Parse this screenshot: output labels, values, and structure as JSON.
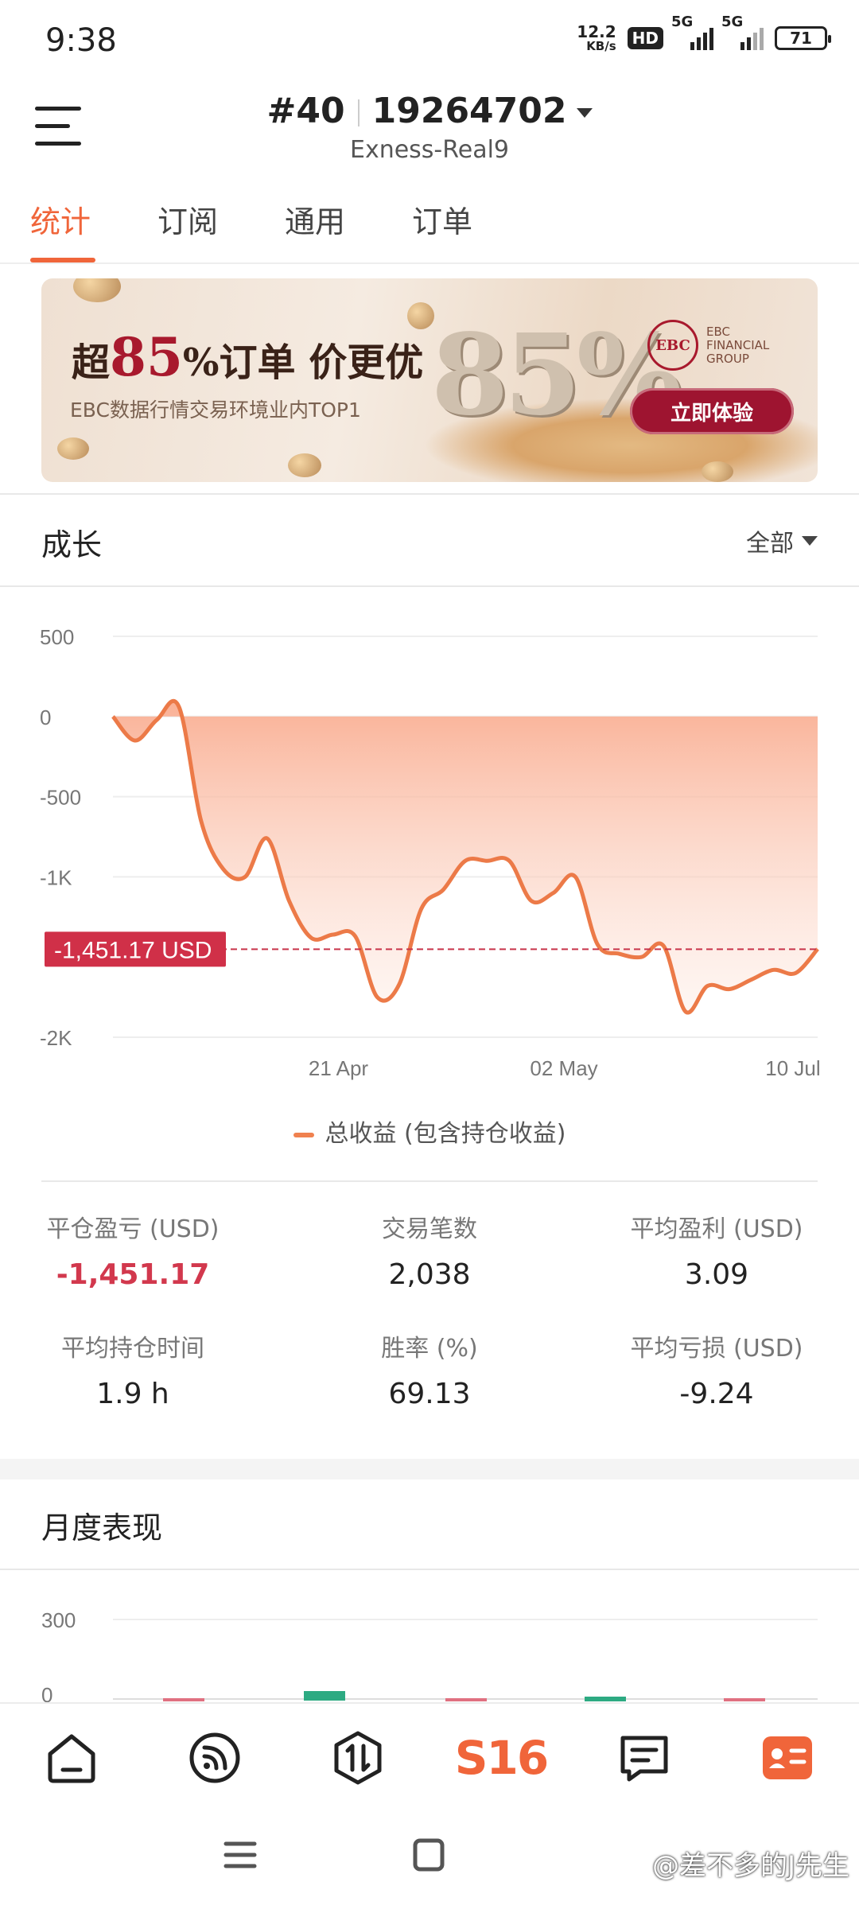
{
  "status_bar": {
    "time": "9:38",
    "net_speed_value": "12.2",
    "net_speed_unit": "KB/s",
    "hd_label": "HD",
    "sim1_label": "5G",
    "sim2_label": "5G",
    "battery": "71"
  },
  "header": {
    "rank": "#40",
    "account_number": "19264702",
    "server": "Exness-Real9"
  },
  "tabs": [
    {
      "label": "统计",
      "active": true
    },
    {
      "label": "订阅",
      "active": false
    },
    {
      "label": "通用",
      "active": false
    },
    {
      "label": "订单",
      "active": false
    }
  ],
  "banner": {
    "headline_prefix": "超",
    "headline_number": "85",
    "headline_suffix": "%订单 价更优",
    "subtitle": "EBC数据行情交易环境业内TOP1",
    "big_number": "85%",
    "logo_mark": "EBC",
    "logo_text_1": "EBC",
    "logo_text_2": "FINANCIAL",
    "logo_text_3": "GROUP",
    "cta_label": "立即体验"
  },
  "growth": {
    "title": "成长",
    "filter_label": "全部"
  },
  "chart_data": {
    "type": "area",
    "ylim": [
      -2000,
      500
    ],
    "y_ticks": [
      "500",
      "0",
      "-500",
      "-1K",
      "-2K"
    ],
    "x_tick_labels": [
      "21 Apr",
      "02 May",
      "10 Jul"
    ],
    "current_label": "-1,451.17 USD",
    "current_value": -1451.17,
    "series": [
      {
        "name": "总收益 (包含持仓收益)",
        "color": "#f0814f",
        "values": [
          0,
          -150,
          -20,
          60,
          -650,
          -950,
          -1000,
          -760,
          -1150,
          -1380,
          -1360,
          -1370,
          -1750,
          -1670,
          -1200,
          -1080,
          -900,
          -900,
          -900,
          -1150,
          -1100,
          -1000,
          -1420,
          -1480,
          -1500,
          -1430,
          -1840,
          -1680,
          -1700,
          -1640,
          -1580,
          -1600,
          -1450
        ]
      }
    ]
  },
  "legend_label": "总收益 (包含持仓收益)",
  "stats": [
    {
      "label": "平仓盈亏 (USD)",
      "value": "-1,451.17",
      "negative": true
    },
    {
      "label": "交易笔数",
      "value": "2,038",
      "negative": false
    },
    {
      "label": "平均盈利 (USD)",
      "value": "3.09",
      "negative": false
    },
    {
      "label": "平均持仓时间",
      "value": "1.9 h",
      "negative": false
    },
    {
      "label": "胜率 (%)",
      "value": "69.13",
      "negative": false
    },
    {
      "label": "平均亏损 (USD)",
      "value": "-9.24",
      "negative": false
    }
  ],
  "monthly": {
    "title": "月度表现",
    "y_ticks": [
      "300",
      "0"
    ]
  },
  "bottom_nav": [
    {
      "icon": "home-icon"
    },
    {
      "icon": "signal-feed-icon"
    },
    {
      "icon": "trade-icon"
    },
    {
      "icon": "s16-logo",
      "label": "S16"
    },
    {
      "icon": "message-icon"
    },
    {
      "icon": "profile-card-icon"
    }
  ],
  "watermark": "@差不多的J先生"
}
